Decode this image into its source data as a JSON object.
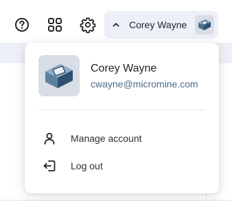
{
  "toolbar": {
    "help_icon": "help-circle-icon",
    "apps_icon": "apps-grid-icon",
    "settings_icon": "gear-icon"
  },
  "user": {
    "name": "Corey Wayne",
    "email": "cwayne@micromine.com",
    "avatar_icon": "3d-block-avatar"
  },
  "menu": {
    "items": [
      {
        "label": "Manage account",
        "icon": "person-icon"
      },
      {
        "label": "Log out",
        "icon": "logout-icon"
      }
    ]
  },
  "colors": {
    "pill_bg": "#eef0f8",
    "email": "#4f6a86",
    "text": "#1f2328"
  }
}
